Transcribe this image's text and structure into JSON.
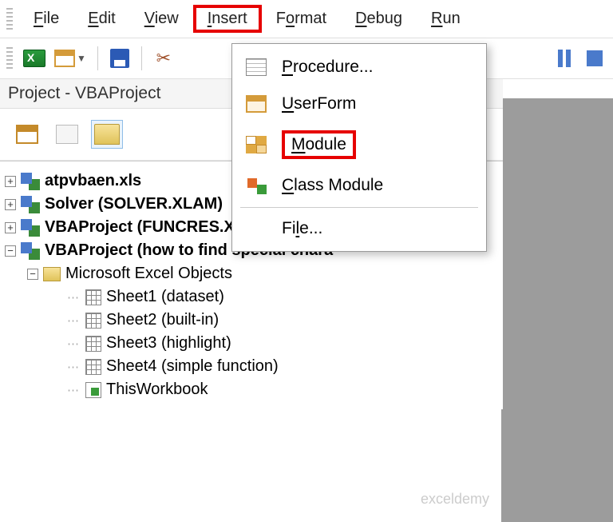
{
  "menubar": {
    "file": "File",
    "edit": "Edit",
    "view": "View",
    "insert": "Insert",
    "format": "Format",
    "debug": "Debug",
    "run": "Run"
  },
  "panel": {
    "title": "Project - VBAProject"
  },
  "dropdown": {
    "procedure": "Procedure...",
    "userform": "UserForm",
    "module": "Module",
    "classmodule": "Class Module",
    "file": "File..."
  },
  "tree": {
    "p1": "atpvbaen.xls",
    "p2": "Solver (SOLVER.XLAM)",
    "p3": "VBAProject (FUNCRES.XLAM)",
    "p4": "VBAProject (how to find special chara",
    "folder": "Microsoft Excel Objects",
    "s1": "Sheet1 (dataset)",
    "s2": "Sheet2 (built-in)",
    "s3": "Sheet3 (highlight)",
    "s4": "Sheet4 (simple function)",
    "wb": "ThisWorkbook"
  },
  "watermark": "exceldemy"
}
